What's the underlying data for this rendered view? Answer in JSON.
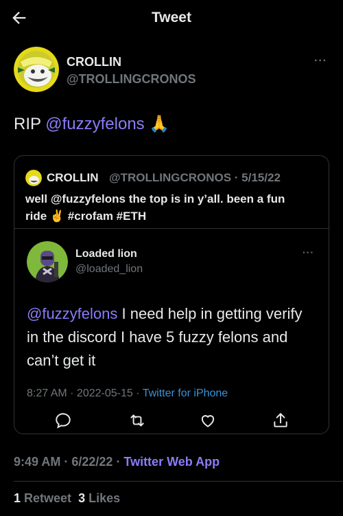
{
  "header": {
    "title": "Tweet",
    "back_icon": "arrow-left-icon"
  },
  "tweet": {
    "author_name": "CROLLIN",
    "author_handle": "@TROLLINGCRONOS",
    "text_prefix": "RIP ",
    "mention": "@fuzzyfelons",
    "emoji": "🙏",
    "timestamp": "9:49 AM · 6/22/22 · ",
    "source": "Twitter Web App",
    "retweets_count": "1",
    "retweets_label": "Retweet",
    "likes_count": "3",
    "likes_label": "Likes"
  },
  "quoted_tweet": {
    "author_name": "CROLLIN",
    "author_handle_date": "@TROLLINGCRONOS · 5/15/22",
    "text_line1": "well @fuzzyfelons the top is in y’all. been a fun",
    "text_line2": "ride ✌️ #crofam #ETH"
  },
  "inner_tweet": {
    "author_name": "Loaded lion",
    "author_handle": "@loaded_lion",
    "mention": "@fuzzyfelons",
    "text": " I need help in getting verify in the discord I have 5 fuzzy felons and can’t get it",
    "timestamp": "8:27 AM · 2022-05-15 · ",
    "source": "Twitter for iPhone",
    "actions": [
      "reply-icon",
      "retweet-icon",
      "like-icon",
      "share-icon"
    ]
  },
  "colors": {
    "background": "#000000",
    "text": "#e7e9ea",
    "muted": "#71767b",
    "mention": "#8b7cf8",
    "source_link": "#3a93d8",
    "border": "#2f3336"
  }
}
